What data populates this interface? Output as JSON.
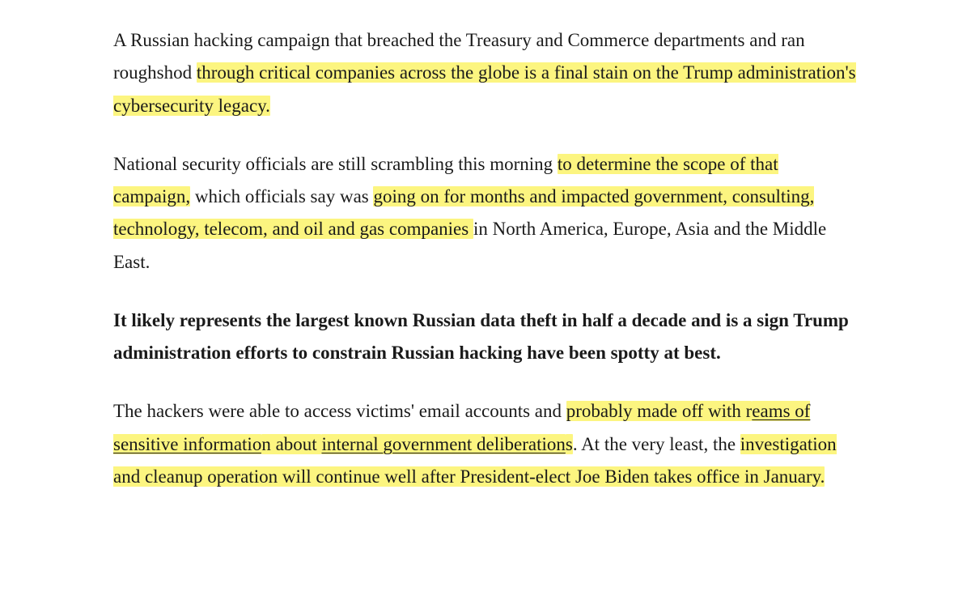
{
  "paragraphs": {
    "p1": {
      "seg1": "A Russian hacking campaign that breached the Treasury and Commerce departments and ran roughshod ",
      "seg2": "through critical companies across the globe is a final stain on the Trump administration's cybersecurity legacy."
    },
    "p2": {
      "seg1": "National security officials are still scrambling this morning ",
      "seg2": "to determine the scope of that campaign,",
      "seg3": " which officials say was ",
      "seg4": "going on for months and impacted government, consulting, technology, telecom, and oil and gas companies ",
      "seg5": "in North America, Europe, Asia and the Middle East."
    },
    "p3": {
      "seg1": "It likely represents the largest known Russian data theft in half a decade and is a sign Trump administration efforts to constrain Russian hacking have been spotty at best",
      "seg2": "."
    },
    "p4": {
      "seg1": "The hackers were able to access victims' email accounts and ",
      "seg2": "probably made off with r",
      "seg3": "eams of sensitive informatio",
      "seg4": "n about ",
      "seg5": "internal government deliberation",
      "seg6": "s",
      "seg7": ". At the very least, the ",
      "seg8": "investigation and cleanup operation will continue well after President-elect Joe Biden takes office in January."
    }
  }
}
